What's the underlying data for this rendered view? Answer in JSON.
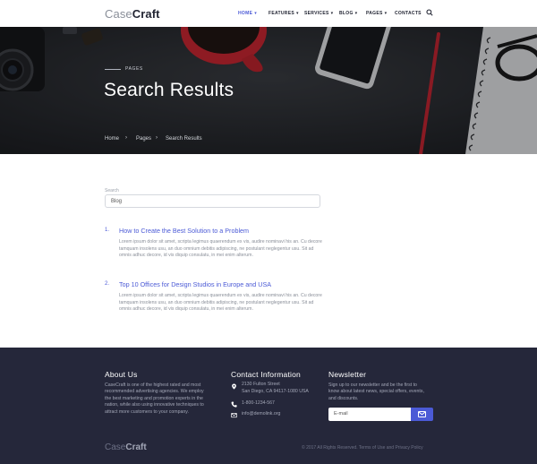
{
  "header": {
    "logo_light": "Case",
    "logo_bold": "Craft",
    "nav": [
      {
        "label": "HOME",
        "has_dropdown": true,
        "active": true
      },
      {
        "label": "FEATURES",
        "has_dropdown": true
      },
      {
        "label": "SERVICES",
        "has_dropdown": true
      },
      {
        "label": "BLOG",
        "has_dropdown": true
      },
      {
        "label": "PAGES",
        "has_dropdown": true
      },
      {
        "label": "CONTACTS",
        "has_dropdown": false
      }
    ],
    "search_icon": "search-icon",
    "chevron": "⌄"
  },
  "hero": {
    "kicker": "PAGES",
    "title": "Search Results",
    "breadcrumb": [
      "Home",
      "Pages",
      "Search Results"
    ],
    "separator": "›"
  },
  "search": {
    "label": "Search",
    "value": "Blog"
  },
  "results": [
    {
      "number": "1.",
      "title": "How to Create the Best Solution to a Problem",
      "excerpt": "Lorem ipsum dolor sit amet, scripta legimus quaerendum ex vis, audire nominavi his an. Cu decore tamquam insolens usu, an duo omnium debitis adipiscing, ne postulant neglegentur usu. Sit ad omnis adhuc decore, id vis diquip consulatu, in mei enim alterum."
    },
    {
      "number": "2.",
      "title": "Top 10 Offices for Design Studios in Europe and USA",
      "excerpt": "Lorem ipsum dolor sit amet, scripta legimus quaerendum ex vis, audire nominavi his an. Cu decore tamquam insolens usu, an duo omnium debitis adipiscing, ne postulant neglegentur usu. Sit ad omnis adhuc decore, id vis diquip consulatu, in mei enim alterum."
    }
  ],
  "footer": {
    "about": {
      "heading": "About Us",
      "text": "CaseCraft is one of the highest rated and most recommended advertising agencies. We employ the best marketing and promotion experts in the nation, while also using innovative techniques to attract more customers to your company."
    },
    "contact": {
      "heading": "Contact Information",
      "address_line1": "2130 Fulton Street",
      "address_line2": "San Diego, CA 94117-1080 USA",
      "phone": "1-800-1234-567",
      "email": "info@demolink.org"
    },
    "newsletter": {
      "heading": "Newsletter",
      "text": "Sign up to our newsletter and be the first to know about latest news, special offers, events, and discounts.",
      "placeholder": "E-mail"
    },
    "logo_light": "Case",
    "logo_bold": "Craft",
    "copyright": "© 2017 All Rights Reserved. Terms of Use and Privacy Policy"
  },
  "colors": {
    "accent": "#4b5ad6",
    "footer_bg": "#25273a",
    "text_muted": "#8a8f99"
  }
}
